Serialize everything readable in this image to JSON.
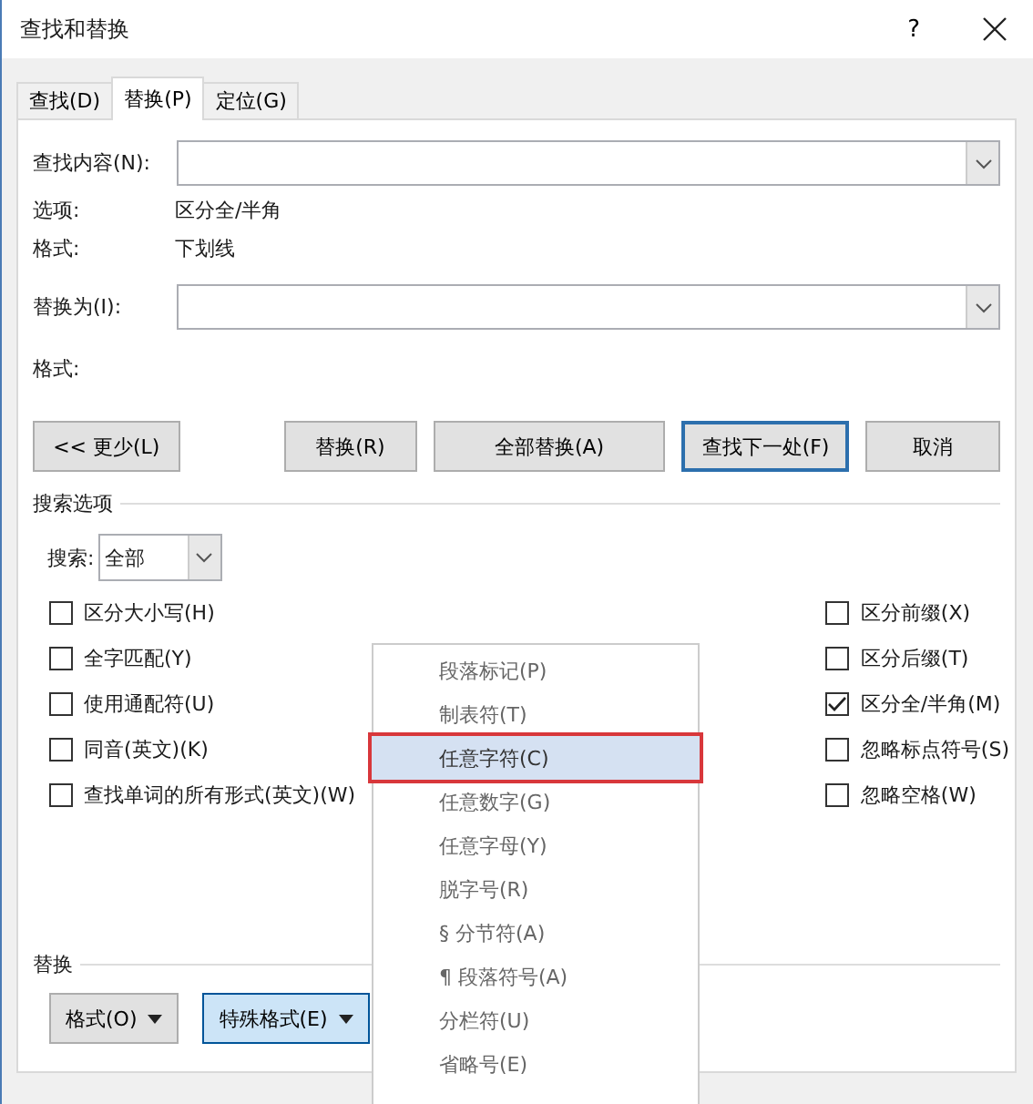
{
  "window": {
    "title": "查找和替换",
    "help": "?"
  },
  "tabs": [
    {
      "label": "查找(D)",
      "selected": false
    },
    {
      "label": "替换(P)",
      "selected": true
    },
    {
      "label": "定位(G)",
      "selected": false
    }
  ],
  "find": {
    "label": "查找内容(N):",
    "options_label": "选项:",
    "options_value": "区分全/半角",
    "format_label": "格式:",
    "format_value": "下划线"
  },
  "replace": {
    "label": "替换为(I):",
    "format_label": "格式:"
  },
  "buttons": [
    {
      "label": "<< 更少(L)",
      "default": false
    },
    {
      "label": "替换(R)",
      "default": false
    },
    {
      "label": "全部替换(A)",
      "default": false
    },
    {
      "label": "查找下一处(F)",
      "default": true
    },
    {
      "label": "取消",
      "default": false
    }
  ],
  "search_options": {
    "title": "搜索选项",
    "search_label": "搜索:",
    "search_value": "全部"
  },
  "left_checks": [
    {
      "label": "区分大小写(H)",
      "checked": false
    },
    {
      "label": "全字匹配(Y)",
      "checked": false
    },
    {
      "label": "使用通配符(U)",
      "checked": false
    },
    {
      "label": "同音(英文)(K)",
      "checked": false
    },
    {
      "label": "查找单词的所有形式(英文)(W)",
      "checked": false
    }
  ],
  "right_checks": [
    {
      "label": "区分前缀(X)",
      "checked": false
    },
    {
      "label": "区分后缀(T)",
      "checked": false
    },
    {
      "label": "区分全/半角(M)",
      "checked": true
    },
    {
      "label": "忽略标点符号(S)",
      "checked": false
    },
    {
      "label": "忽略空格(W)",
      "checked": false
    }
  ],
  "replace_section": {
    "title": "替换",
    "buttons": [
      {
        "label": "格式(O)",
        "pressed": false
      },
      {
        "label": "特殊格式(E)",
        "pressed": true
      }
    ]
  },
  "menu": {
    "items": [
      {
        "label": "段落标记(P)",
        "selected": false
      },
      {
        "label": "制表符(T)",
        "selected": false
      },
      {
        "label": "任意字符(C)",
        "selected": true
      },
      {
        "label": "任意数字(G)",
        "selected": false
      },
      {
        "label": "任意字母(Y)",
        "selected": false
      },
      {
        "label": "脱字号(R)",
        "selected": false
      },
      {
        "label": "§ 分节符(A)",
        "selected": false
      },
      {
        "label": "¶ 段落符号(A)",
        "selected": false
      },
      {
        "label": "分栏符(U)",
        "selected": false
      },
      {
        "label": "省略号(E)",
        "selected": false
      }
    ]
  }
}
